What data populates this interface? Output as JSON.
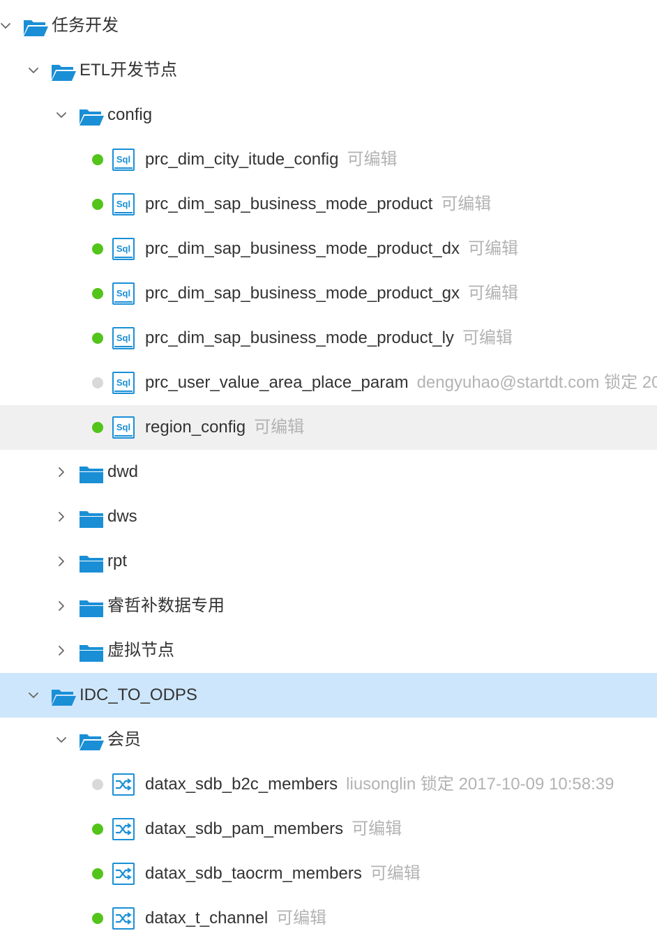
{
  "tree": {
    "rows": [
      {
        "type": "folder",
        "level": 0,
        "expanded": true,
        "name": "任务开发",
        "state": ""
      },
      {
        "type": "folder",
        "level": 1,
        "expanded": true,
        "name": "ETL开发节点",
        "state": ""
      },
      {
        "type": "folder",
        "level": 2,
        "expanded": true,
        "name": "config",
        "state": ""
      },
      {
        "type": "file",
        "icon": "sql-file-icon",
        "level": 3,
        "dot": "green",
        "name": "prc_dim_city_itude_config",
        "status": "可编辑",
        "state": ""
      },
      {
        "type": "file",
        "icon": "sql-file-icon",
        "level": 3,
        "dot": "green",
        "name": "prc_dim_sap_business_mode_product",
        "status": "可编辑",
        "state": ""
      },
      {
        "type": "file",
        "icon": "sql-file-icon",
        "level": 3,
        "dot": "green",
        "name": "prc_dim_sap_business_mode_product_dx",
        "status": "可编辑",
        "state": ""
      },
      {
        "type": "file",
        "icon": "sql-file-icon",
        "level": 3,
        "dot": "green",
        "name": "prc_dim_sap_business_mode_product_gx",
        "status": "可编辑",
        "state": ""
      },
      {
        "type": "file",
        "icon": "sql-file-icon",
        "level": 3,
        "dot": "green",
        "name": "prc_dim_sap_business_mode_product_ly",
        "status": "可编辑",
        "state": ""
      },
      {
        "type": "file",
        "icon": "sql-file-icon",
        "level": 3,
        "dot": "grey",
        "name": "prc_user_value_area_place_param",
        "status": "dengyuhao@startdt.com 锁定 20",
        "state": ""
      },
      {
        "type": "file",
        "icon": "sql-file-icon",
        "level": 3,
        "dot": "green",
        "name": "region_config",
        "status": "可编辑",
        "state": "hover"
      },
      {
        "type": "folder",
        "level": 2,
        "expanded": false,
        "name": "dwd",
        "state": ""
      },
      {
        "type": "folder",
        "level": 2,
        "expanded": false,
        "name": "dws",
        "state": ""
      },
      {
        "type": "folder",
        "level": 2,
        "expanded": false,
        "name": "rpt",
        "state": ""
      },
      {
        "type": "folder",
        "level": 2,
        "expanded": false,
        "name": "睿哲补数据专用",
        "state": ""
      },
      {
        "type": "folder",
        "level": 2,
        "expanded": false,
        "name": "虚拟节点",
        "state": ""
      },
      {
        "type": "folder",
        "level": 1,
        "expanded": true,
        "name": "IDC_TO_ODPS",
        "state": "selected"
      },
      {
        "type": "folder",
        "level": 2,
        "expanded": true,
        "name": "会员",
        "state": ""
      },
      {
        "type": "file",
        "icon": "datax-sync-icon",
        "level": 3,
        "dot": "grey",
        "name": "datax_sdb_b2c_members",
        "status": "liusonglin 锁定 2017-10-09 10:58:39",
        "state": ""
      },
      {
        "type": "file",
        "icon": "datax-sync-icon",
        "level": 3,
        "dot": "green",
        "name": "datax_sdb_pam_members",
        "status": "可编辑",
        "state": ""
      },
      {
        "type": "file",
        "icon": "datax-sync-icon",
        "level": 3,
        "dot": "green",
        "name": "datax_sdb_taocrm_members",
        "status": "可编辑",
        "state": ""
      },
      {
        "type": "file",
        "icon": "datax-sync-icon",
        "level": 3,
        "dot": "green",
        "name": "datax_t_channel",
        "status": "可编辑",
        "state": ""
      }
    ]
  },
  "colors": {
    "folder": "#1a8fd6",
    "icon_blue": "#1a8fd6",
    "dot_green": "#52c41a",
    "dot_grey": "#d9d9d9",
    "selected_bg": "#cde6fb",
    "hover_bg": "#f0f0f0",
    "status_text": "#b3b3b3"
  }
}
